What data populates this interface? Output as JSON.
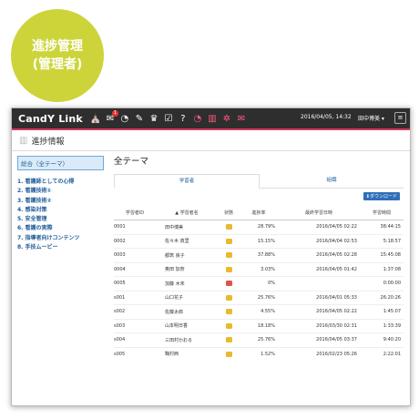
{
  "badge": {
    "line1": "進捗管理",
    "line2": "(管理者)"
  },
  "navbar": {
    "brand": "CandY Link",
    "icons": [
      "sakura-icon",
      "mail-icon",
      "dashboard-icon",
      "edit-icon",
      "crown-icon",
      "check-icon",
      "help-icon",
      "dashboard-icon",
      "bar-chart-icon",
      "users-icon",
      "mail-icon"
    ],
    "notification_count": "1",
    "datetime": "2016/04/05, 14:32",
    "user": "田中博美 ▾",
    "menu": "≡"
  },
  "page": {
    "title": "進捗情報"
  },
  "sidebar": {
    "selected": "総合（全テーマ）",
    "items": [
      "1. 看護師としての心得",
      "2. 看護技術①",
      "3. 看護技術②",
      "4. 感染対策",
      "5. 安全管理",
      "6. 看護の実際",
      "7. 指導者向けコンテンツ",
      "8. 手技ムービー"
    ]
  },
  "main": {
    "title": "全テーマ",
    "tabs": [
      "学習者",
      "組織"
    ],
    "download": "⬇ダウンロード",
    "columns": [
      "学習者ID",
      "学習者名",
      "状態",
      "進捗率",
      "最終学習日時",
      "学習時間"
    ],
    "sort_icon": "▲",
    "rows": [
      {
        "id": "0001",
        "name": "田中博美",
        "status": "yellow",
        "progress": "28.79%",
        "last": "2016/04/05 02:22",
        "time": "38:44:15"
      },
      {
        "id": "0002",
        "name": "佐々木 真里",
        "status": "yellow",
        "progress": "15.15%",
        "last": "2016/04/04 02:53",
        "time": "5:18:57"
      },
      {
        "id": "0003",
        "name": "都筑 良子",
        "status": "yellow",
        "progress": "37.88%",
        "last": "2016/04/05 02:28",
        "time": "15:45:08"
      },
      {
        "id": "0004",
        "name": "奥田 加奈",
        "status": "yellow",
        "progress": "3.03%",
        "last": "2016/04/05 01:42",
        "time": "1:37:08"
      },
      {
        "id": "0005",
        "name": "加藤 木末",
        "status": "red",
        "progress": "0%",
        "last": "",
        "time": "0:00:00"
      },
      {
        "id": "s001",
        "name": "山口花子",
        "status": "yellow",
        "progress": "25.76%",
        "last": "2016/04/01 05:33",
        "time": "26:20:26"
      },
      {
        "id": "s002",
        "name": "佐藤太郎",
        "status": "yellow",
        "progress": "4.55%",
        "last": "2016/04/05 02:22",
        "time": "1:45:07"
      },
      {
        "id": "s003",
        "name": "山本明日香",
        "status": "yellow",
        "progress": "18.18%",
        "last": "2016/03/30 02:31",
        "time": "1:33:39"
      },
      {
        "id": "s004",
        "name": "三田村かおる",
        "status": "yellow",
        "progress": "25.76%",
        "last": "2016/04/05 03:37",
        "time": "9:40:20"
      },
      {
        "id": "s005",
        "name": "鞠村西",
        "status": "yellow",
        "progress": "1.52%",
        "last": "2016/02/23 05:26",
        "time": "2:22:01"
      }
    ]
  }
}
